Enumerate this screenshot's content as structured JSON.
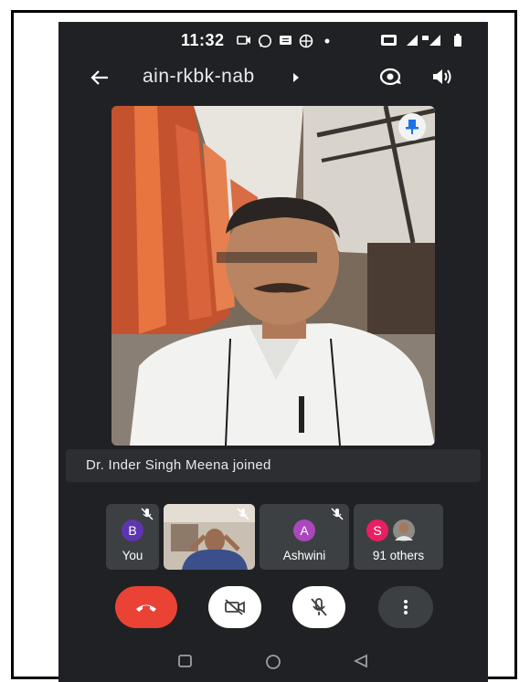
{
  "status_bar": {
    "time": "11:32"
  },
  "header": {
    "meeting_code": "ain-rkbk-nab"
  },
  "notification": {
    "text": "Dr. Inder Singh Meena joined"
  },
  "participants": [
    {
      "initial": "B",
      "label": "You",
      "avatar_color": "#5e35b1"
    },
    {
      "label": ""
    },
    {
      "initial": "A",
      "label": "Ashwini",
      "avatar_color": "#ab47bc"
    },
    {
      "initial": "S",
      "label": "91 others",
      "avatar_color": "#e91e63"
    }
  ],
  "colors": {
    "end_call": "#ea4335",
    "background": "#202124",
    "tile": "#3c4043"
  },
  "icons": [
    "back-arrow-icon",
    "switch-camera-icon",
    "speaker-icon",
    "pin-icon",
    "end-call-icon",
    "camera-off-icon",
    "mic-off-icon",
    "more-options-icon"
  ]
}
